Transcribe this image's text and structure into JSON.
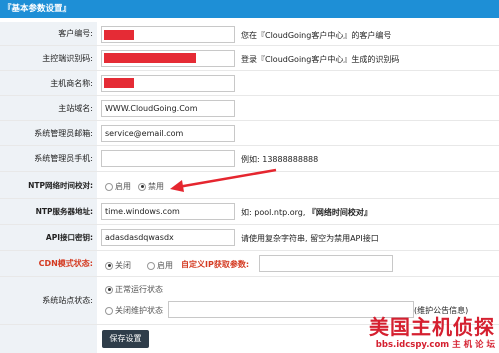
{
  "section_title": "『基本参数设置』",
  "rows": {
    "customer_id": {
      "label": "客户编号:",
      "hint": "您在『CloudGoing客户中心』的客户编号"
    },
    "auth_code": {
      "label": "主控端识别码:",
      "hint": "登录『CloudGoing客户中心』生成的识别码"
    },
    "host_name": {
      "label": "主机商名称:"
    },
    "site_domain": {
      "label": "主站域名:",
      "value": "WWW.CloudGoing.Com"
    },
    "admin_email": {
      "label": "系统管理员邮箱:",
      "value": "service@email.com"
    },
    "admin_phone": {
      "label": "系统管理员手机:",
      "value": "",
      "hint": "例如: 13888888888"
    },
    "ntp_check": {
      "label": "NTP网络时间校对:",
      "options": [
        "启用",
        "禁用"
      ],
      "selected": "禁用"
    },
    "ntp_server": {
      "label": "NTP服务器地址:",
      "value": "time.windows.com",
      "hint_prefix": "如: pool.ntp.org, ",
      "hint_bold": "『网络时间校对』"
    },
    "api_key": {
      "label": "API接口密钥:",
      "value": "adasdasdqwasdx",
      "hint": "请使用复杂字符串, 留空为禁用API接口"
    },
    "cdn_mode": {
      "label": "CDN模式状态:",
      "options": [
        "关闭",
        "启用"
      ],
      "selected": "关闭",
      "custom_ip_label": "自定义IP获取参数:",
      "custom_ip_value": ""
    },
    "site_status": {
      "label": "系统站点状态:",
      "options": [
        "正常运行状态",
        "关闭维护状态"
      ],
      "selected": "正常运行状态",
      "maintenance_hint": "(维护公告信息)"
    }
  },
  "save_button": "保存设置",
  "watermark": {
    "title": "美国主机侦探",
    "subtitle": "bbs.idcspy.com 主 机 论 坛"
  },
  "colors": {
    "header": "#1e8fd6",
    "redaction": "#e52b35",
    "label_bg": "#eef2f6",
    "annotation_arrow": "#e5262f"
  }
}
